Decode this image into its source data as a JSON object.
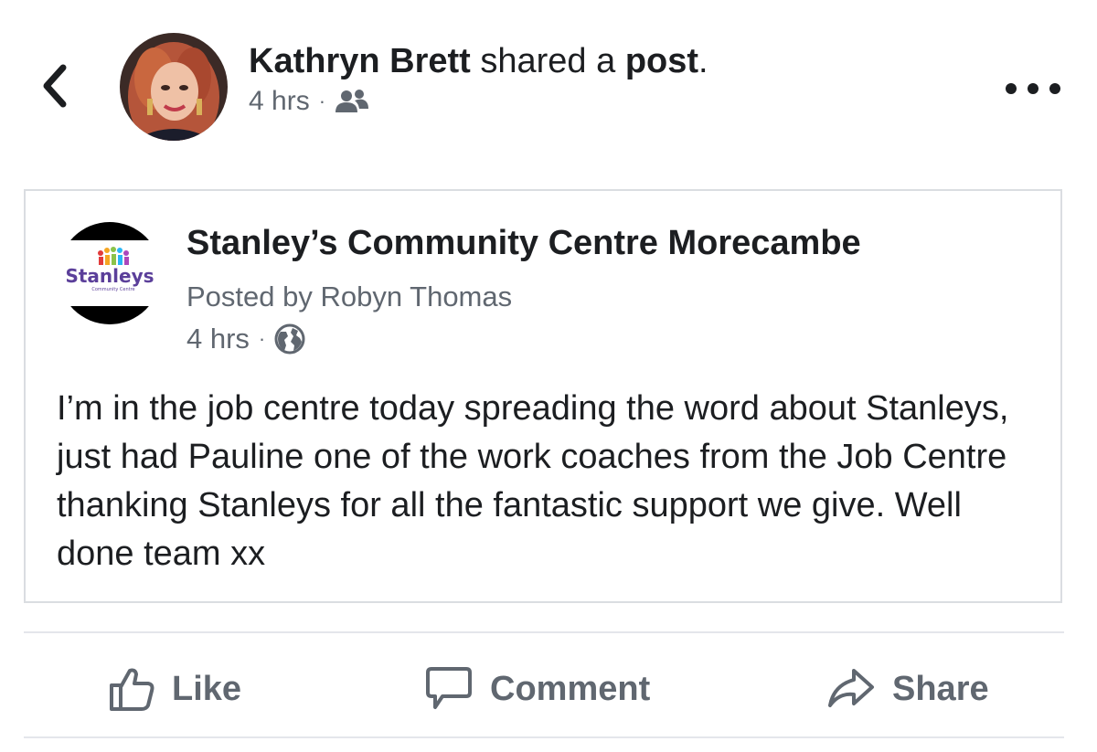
{
  "header": {
    "author": "Kathryn Brett",
    "action_text": "shared a",
    "object_text": "post",
    "period": ".",
    "timestamp": "4 hrs",
    "separator": "·",
    "audience_icon": "friends-icon"
  },
  "shared_post": {
    "page_name": "Stanley’s Community Centre Morecambe",
    "logo_text": "Stanleys",
    "logo_subtext": "Community Centre",
    "posted_by": "Posted by Robyn Thomas",
    "timestamp": "4 hrs",
    "separator": "·",
    "audience_icon": "globe-icon",
    "body": "I’m in the job centre today spreading the word about Stanleys, just had Pauline one of the work coaches from the Job Centre thanking Stanleys for all the fantastic support we give. Well done team xx"
  },
  "actions": {
    "like": "Like",
    "comment": "Comment",
    "share": "Share"
  },
  "colors": {
    "primary_text": "#1c1e21",
    "secondary_text": "#606770",
    "border": "#dadde1"
  }
}
